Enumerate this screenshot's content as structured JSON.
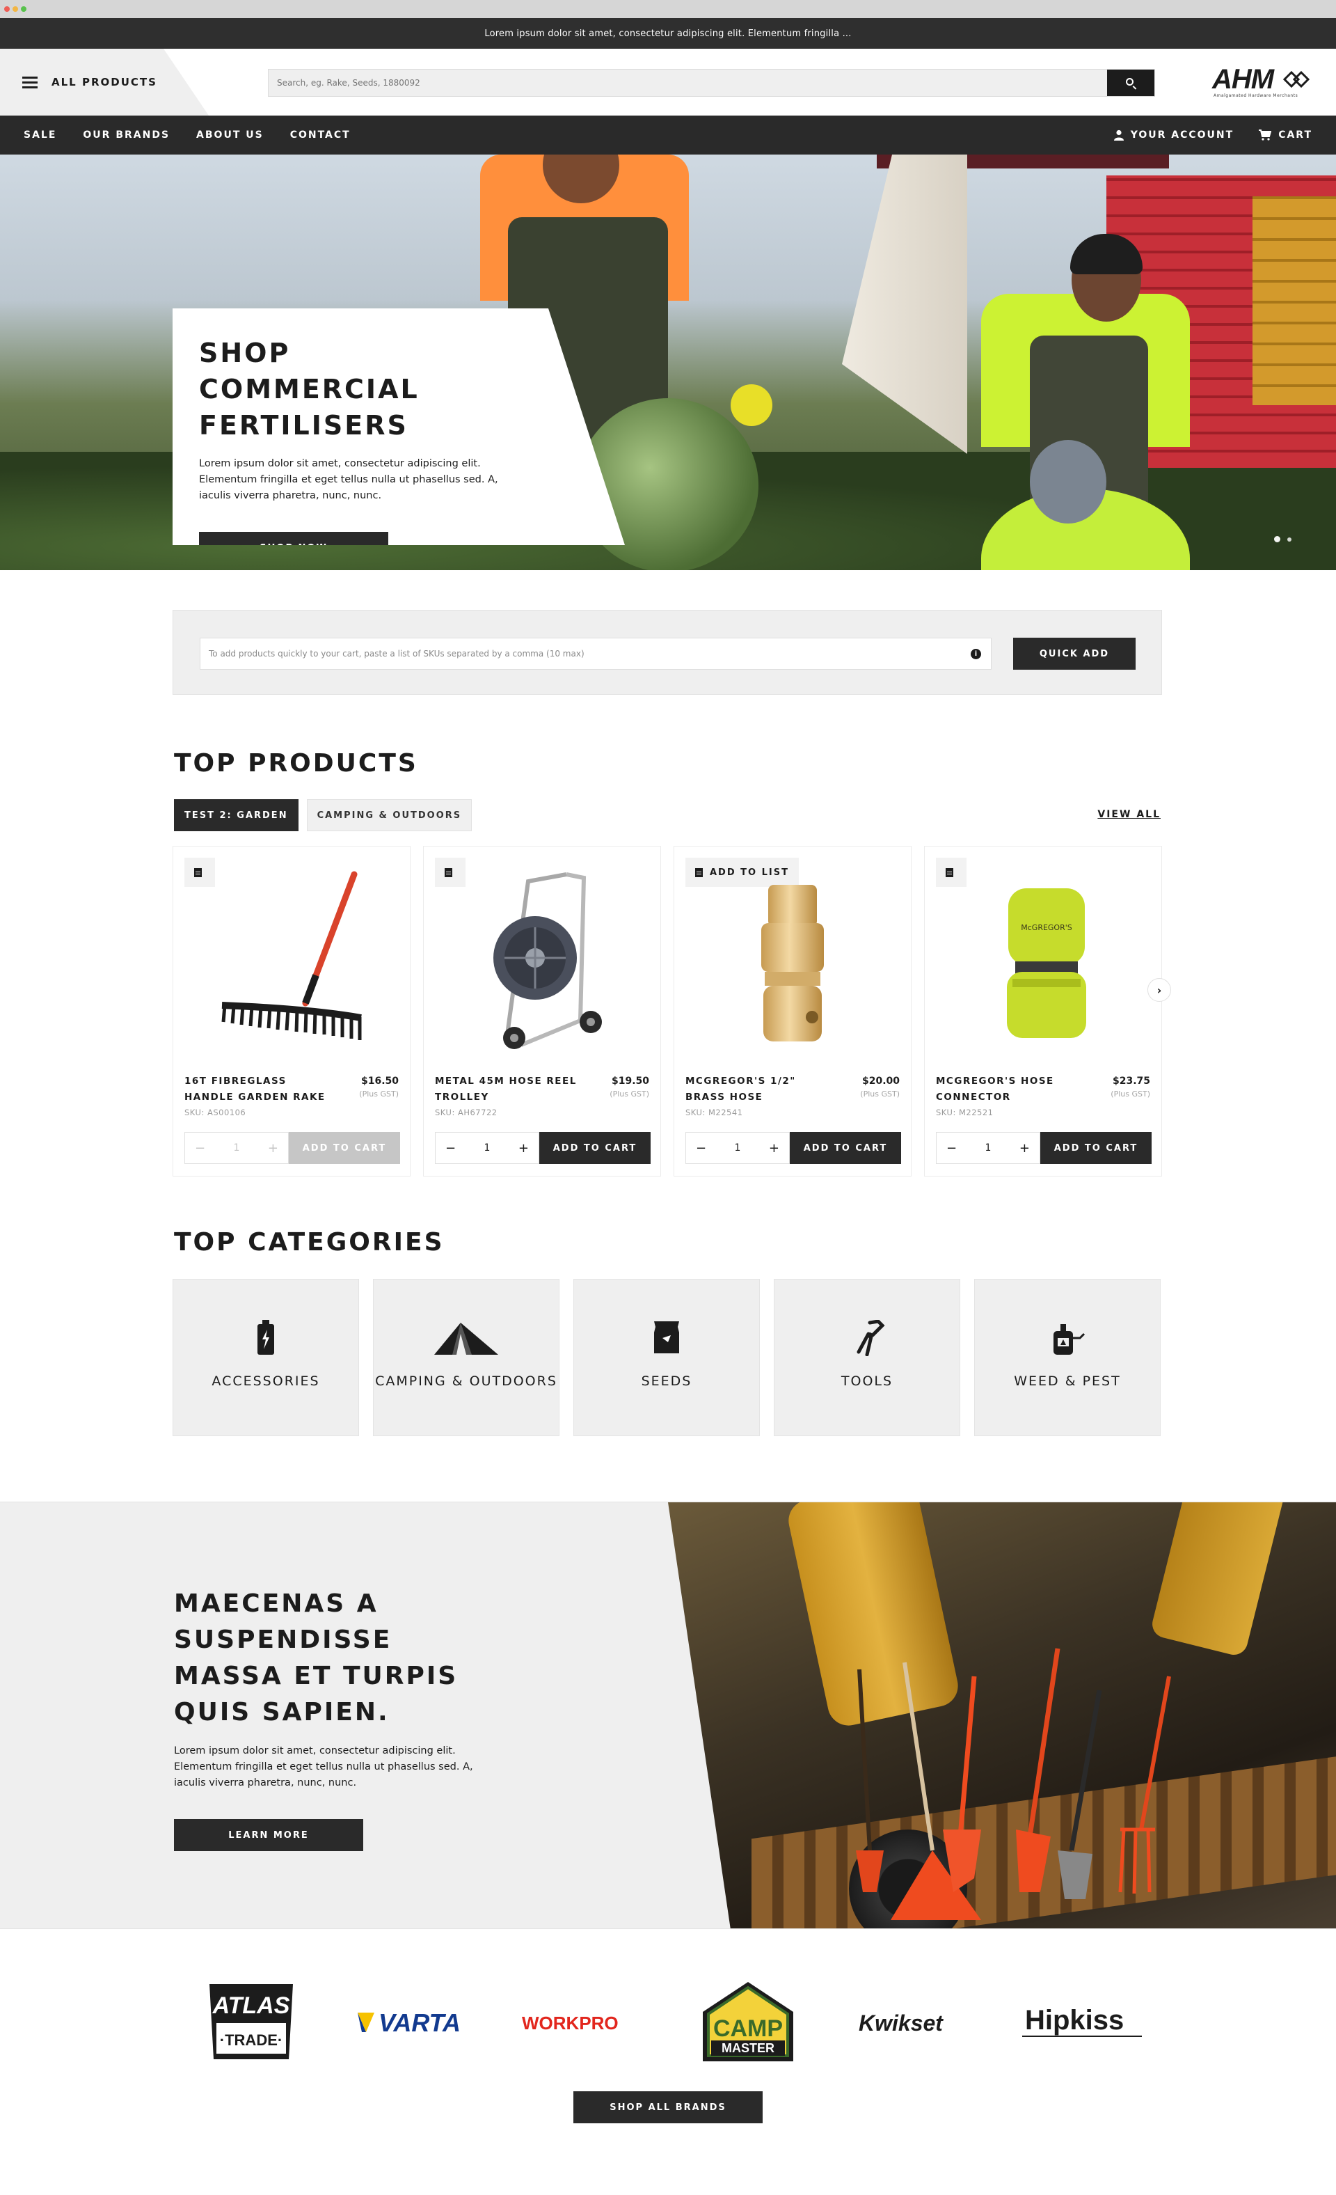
{
  "announcement": "Lorem ipsum dolor sit amet, consectetur adipiscing elit. Elementum fringilla ...",
  "header": {
    "all_products": "ALL PRODUCTS",
    "search_placeholder": "Search, eg. Rake, Seeds, 1880092",
    "logo_text": "AHM",
    "logo_tagline": "Amalgamated Hardware Merchants"
  },
  "nav": {
    "items": [
      "SALE",
      "OUR BRANDS",
      "ABOUT US",
      "CONTACT"
    ],
    "account": "YOUR ACCOUNT",
    "cart": "CART"
  },
  "hero": {
    "title": "SHOP COMMERCIAL FERTILISERS",
    "body": "Lorem ipsum dolor sit amet, consectetur adipiscing elit. Elementum fringilla et eget tellus nulla ut phasellus sed. A, iaculis viverra pharetra, nunc, nunc.",
    "cta": "SHOP NOW",
    "slide_count": 2,
    "active_slide": 1
  },
  "quick_add": {
    "placeholder": "To add products quickly to your cart, paste a list of SKUs separated by a comma (10 max)",
    "info_glyph": "i",
    "button": "QUICK ADD"
  },
  "top_products": {
    "title": "TOP PRODUCTS",
    "tabs": [
      "TEST 2: GARDEN",
      "CAMPING & OUTDOORS"
    ],
    "active_tab": 0,
    "view_all": "VIEW ALL",
    "add_to_list": "ADD TO LIST",
    "products": [
      {
        "name": "16T FIBREGLASS HANDLE GARDEN RAKE",
        "price": "$16.50",
        "gst": "(Plus GST)",
        "sku": "SKU: AS00106",
        "qty": "1",
        "button": "ADD TO CART",
        "disabled": true,
        "image": "garden-rake-image"
      },
      {
        "name": "METAL 45M HOSE REEL TROLLEY",
        "price": "$19.50",
        "gst": "(Plus GST)",
        "sku": "SKU: AH67722",
        "qty": "1",
        "button": "ADD TO CART",
        "disabled": false,
        "image": "hose-reel-trolley-image"
      },
      {
        "name": "MCGREGOR'S 1/2\" BRASS HOSE",
        "price": "$20.00",
        "gst": "(Plus GST)",
        "sku": "SKU: M22541",
        "qty": "1",
        "button": "ADD TO CART",
        "disabled": false,
        "image": "brass-hose-fitting-image"
      },
      {
        "name": "MCGREGOR'S HOSE CONNECTOR",
        "price": "$23.75",
        "gst": "(Plus GST)",
        "sku": "SKU: M22521",
        "qty": "1",
        "button": "ADD TO CART",
        "disabled": false,
        "image": "hose-connector-image",
        "product_label": "McGREGOR'S"
      }
    ],
    "qty_minus": "−",
    "qty_plus": "+",
    "next_glyph": "›"
  },
  "top_categories": {
    "title": "TOP CATEGORIES",
    "items": [
      {
        "name": "ACCESSORIES",
        "icon": "battery-icon"
      },
      {
        "name": "CAMPING & OUTDOORS",
        "icon": "tent-icon"
      },
      {
        "name": "SEEDS",
        "icon": "seed-packet-icon"
      },
      {
        "name": "TOOLS",
        "icon": "pliers-icon"
      },
      {
        "name": "WEED & PEST",
        "icon": "sprayer-icon"
      }
    ]
  },
  "promo": {
    "title": "MAECENAS A SUSPENDISSE MASSA ET TURPIS QUIS SAPIEN.",
    "body": "Lorem ipsum dolor sit amet, consectetur adipiscing elit. Elementum fringilla et eget tellus nulla ut phasellus sed. A, iaculis viverra pharetra, nunc, nunc.",
    "cta": "LEARN MORE"
  },
  "brands": {
    "logos": [
      "ATLAS TRADE",
      "VARTA",
      "WORKPRO",
      "CAMP MASTER",
      "Kwikset",
      "Hipkiss"
    ],
    "atlas_top": "ATLAS",
    "atlas_bottom": "·TRADE·",
    "varta": "VARTA",
    "workpro": "WORKPRO",
    "camp_top": "CAMP",
    "camp_bottom": "MASTER",
    "kwikset": "Kwikset",
    "hipkiss": "Hipkiss",
    "cta": "SHOP ALL BRANDS"
  },
  "colors": {
    "dark": "#2a2a2a",
    "light_panel": "#efefef",
    "workpro_red": "#e2261d",
    "varta_blue": "#123a8f",
    "varta_yellow": "#f6c200",
    "camp_green": "#3a6a2a",
    "camp_yellow": "#f3d23a"
  }
}
